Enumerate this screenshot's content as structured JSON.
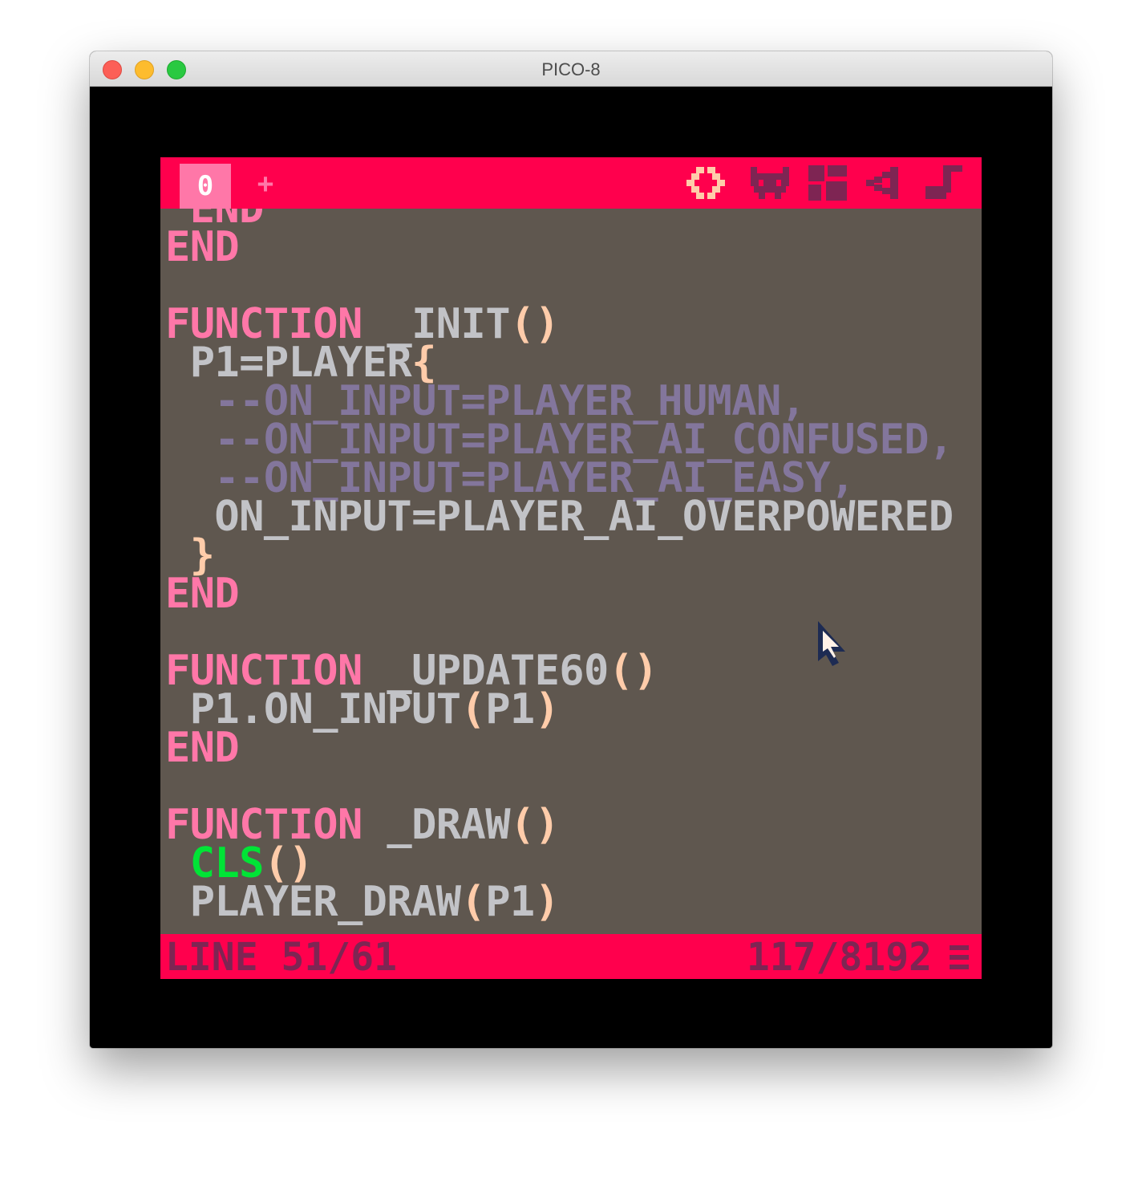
{
  "window": {
    "title": "PICO-8"
  },
  "editor": {
    "tab_label": "0",
    "add_tab_label": "+",
    "modes": [
      {
        "name": "code-editor-icon",
        "active": true
      },
      {
        "name": "sprite-editor-icon",
        "active": false
      },
      {
        "name": "map-editor-icon",
        "active": false
      },
      {
        "name": "sfx-editor-icon",
        "active": false
      },
      {
        "name": "music-editor-icon",
        "active": false
      }
    ],
    "code_lines": [
      {
        "indent": " ",
        "segments": [
          {
            "c": "kw",
            "t": "END"
          }
        ]
      },
      {
        "indent": "",
        "segments": [
          {
            "c": "kw",
            "t": "END"
          }
        ]
      },
      {
        "indent": "",
        "segments": []
      },
      {
        "indent": "",
        "segments": [
          {
            "c": "kw",
            "t": "FUNCTION"
          },
          {
            "c": "tx",
            "t": " _INIT"
          },
          {
            "c": "pu",
            "t": "()"
          }
        ]
      },
      {
        "indent": " ",
        "segments": [
          {
            "c": "tx",
            "t": "P1=PLAYER"
          },
          {
            "c": "pu",
            "t": "{"
          }
        ]
      },
      {
        "indent": "  ",
        "segments": [
          {
            "c": "cm",
            "t": "--ON_INPUT=PLAYER_HUMAN,"
          }
        ]
      },
      {
        "indent": "  ",
        "segments": [
          {
            "c": "cm",
            "t": "--ON_INPUT=PLAYER_AI_CONFUSED,"
          }
        ]
      },
      {
        "indent": "  ",
        "segments": [
          {
            "c": "cm",
            "t": "--ON_INPUT=PLAYER_AI_EASY,"
          }
        ]
      },
      {
        "indent": "  ",
        "segments": [
          {
            "c": "tx",
            "t": "ON_INPUT=PLAYER_AI_OVERPOWERED"
          }
        ]
      },
      {
        "indent": " ",
        "segments": [
          {
            "c": "pu",
            "t": "}"
          }
        ]
      },
      {
        "indent": "",
        "segments": [
          {
            "c": "kw",
            "t": "END"
          }
        ]
      },
      {
        "indent": "",
        "segments": []
      },
      {
        "indent": "",
        "segments": [
          {
            "c": "kw",
            "t": "FUNCTION"
          },
          {
            "c": "tx",
            "t": " _UPDATE60"
          },
          {
            "c": "pu",
            "t": "()"
          }
        ]
      },
      {
        "indent": " ",
        "segments": [
          {
            "c": "tx",
            "t": "P1.ON_INPUT"
          },
          {
            "c": "pu",
            "t": "("
          },
          {
            "c": "tx",
            "t": "P1"
          },
          {
            "c": "pu",
            "t": ")"
          }
        ]
      },
      {
        "indent": "",
        "segments": [
          {
            "c": "kw",
            "t": "END"
          }
        ]
      },
      {
        "indent": "",
        "segments": []
      },
      {
        "indent": "",
        "segments": [
          {
            "c": "kw",
            "t": "FUNCTION"
          },
          {
            "c": "tx",
            "t": " _DRAW"
          },
          {
            "c": "pu",
            "t": "()"
          }
        ]
      },
      {
        "indent": " ",
        "segments": [
          {
            "c": "fn",
            "t": "CLS"
          },
          {
            "c": "pu",
            "t": "()"
          }
        ]
      },
      {
        "indent": " ",
        "segments": [
          {
            "c": "tx",
            "t": "PLAYER_DRAW"
          },
          {
            "c": "pu",
            "t": "("
          },
          {
            "c": "tx",
            "t": "P1"
          },
          {
            "c": "pu",
            "t": ")"
          }
        ]
      }
    ],
    "status": {
      "line": "LINE 51/61",
      "tokens": "117/8192"
    }
  },
  "colors": {
    "bar": "#ff004d",
    "bar_text": "#7e2553",
    "tab": "#ff77a8",
    "background": "#5f574f",
    "keyword": "#ff77a8",
    "comment": "#83769c",
    "punctuation": "#ffccaa",
    "builtin": "#00e436",
    "text": "#c2c3c7",
    "cursor": "#1d2b53"
  }
}
